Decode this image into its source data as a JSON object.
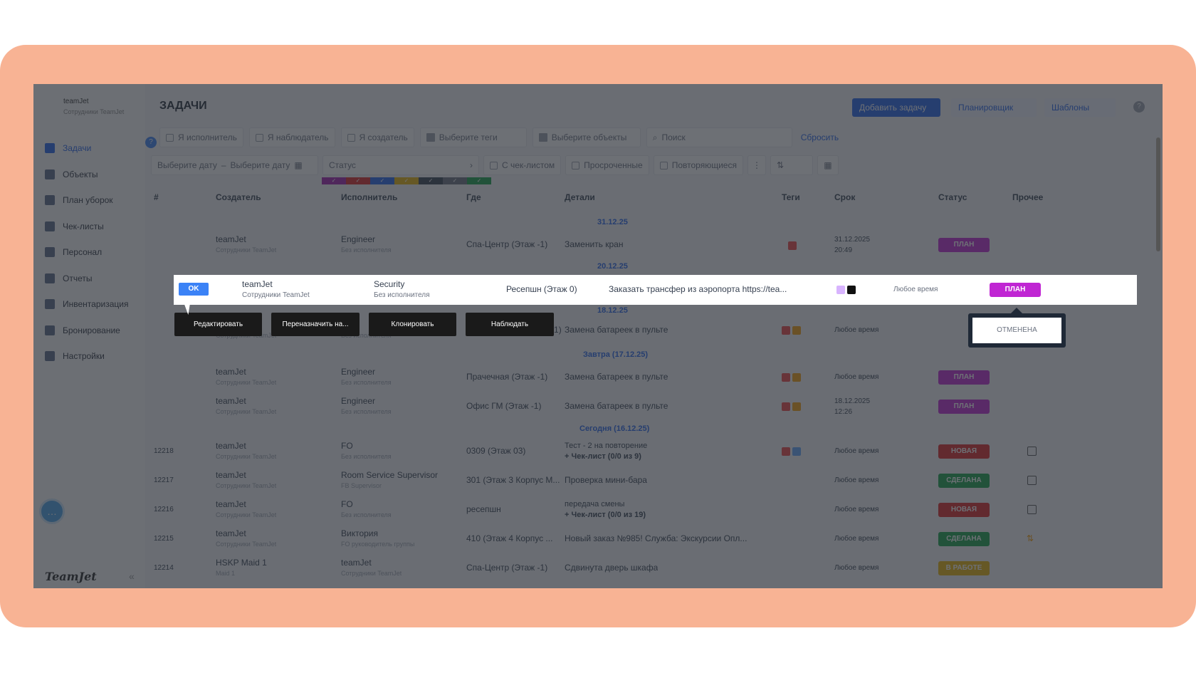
{
  "brand": {
    "name": "teamJet",
    "sub": "Сотрудники TeamJet",
    "logo": "TeamJet"
  },
  "sidebar": {
    "items": [
      {
        "label": "Задачи",
        "icon": "tasks-icon",
        "active": true
      },
      {
        "label": "Объекты",
        "icon": "objects-icon"
      },
      {
        "label": "План уборок",
        "icon": "cleaning-plan-icon"
      },
      {
        "label": "Чек-листы",
        "icon": "checklist-icon"
      },
      {
        "label": "Персонал",
        "icon": "staff-icon"
      },
      {
        "label": "Отчеты",
        "icon": "reports-icon"
      },
      {
        "label": "Инвентаризация",
        "icon": "inventory-icon"
      },
      {
        "label": "Бронирование",
        "icon": "booking-icon"
      },
      {
        "label": "Настройки",
        "icon": "settings-icon"
      }
    ]
  },
  "header": {
    "title": "ЗАДАЧИ",
    "add_task": "Добавить задачу",
    "planning": "Планировщик",
    "templates": "Шаблоны"
  },
  "filters": {
    "executor": "Я исполнитель",
    "observer": "Я наблюдатель",
    "creator": "Я создатель",
    "tags": "Выберите теги",
    "objects": "Выберите объекты",
    "search_placeholder": "Поиск",
    "reset": "Сбросить",
    "date_from": "Выберите дату",
    "date_to": "Выберите дату",
    "status": "Статус",
    "with_checklist": "С чек-листом",
    "overdue": "Просроченные",
    "recurring": "Повторяющиеся"
  },
  "columns": [
    "#",
    "Создатель",
    "Исполнитель",
    "Где",
    "Детали",
    "Теги",
    "Срок",
    "Статус",
    "Прочее"
  ],
  "dates": {
    "d1": "31.12.25",
    "d2": "20.12.25",
    "d3": "18.12.25",
    "d4": "Завтра (17.12.25)",
    "d5": "Сегодня (16.12.25)"
  },
  "rows": [
    {
      "id": "",
      "creator": "teamJet",
      "creator_sub": "Сотрудники TeamJet",
      "exec": "Engineer",
      "exec_sub": "Без исполнителя",
      "where": "Спа-Центр (Этаж -1)",
      "details": "Заменить кран",
      "details2": "",
      "deadline": "31.12.2025",
      "deadline2": "20:49",
      "status": "ПЛАН"
    },
    {
      "id": "",
      "creator": "",
      "creator_sub": "Сотрудники TeamJet",
      "exec": "",
      "exec_sub": "Без исполнителя",
      "where": "Этаж -1)",
      "details": "Замена батареек в пульте",
      "details2": "",
      "deadline": "Любое время",
      "deadline2": "",
      "status": ""
    },
    {
      "id": "",
      "creator": "teamJet",
      "creator_sub": "Сотрудники TeamJet",
      "exec": "Engineer",
      "exec_sub": "Без исполнителя",
      "where": "Прачечная (Этаж -1)",
      "details": "Замена батареек в пульте",
      "details2": "",
      "deadline": "Любое время",
      "deadline2": "",
      "status": "ПЛАН"
    },
    {
      "id": "",
      "creator": "teamJet",
      "creator_sub": "Сотрудники TeamJet",
      "exec": "Engineer",
      "exec_sub": "Без исполнителя",
      "where": "Офис ГМ (Этаж -1)",
      "details": "Замена батареек в пульте",
      "details2": "",
      "deadline": "18.12.2025",
      "deadline2": "12:26",
      "status": "ПЛАН"
    },
    {
      "id": "12218",
      "creator": "teamJet",
      "creator_sub": "Сотрудники TeamJet",
      "exec": "FO",
      "exec_sub": "Без исполнителя",
      "where": "0309 (Этаж 03)",
      "details": "Тест - 2 на повторение",
      "details2": "+ Чек-лист (0/0 из 9)",
      "deadline": "Любое время",
      "deadline2": "",
      "status": "НОВАЯ"
    },
    {
      "id": "12217",
      "creator": "teamJet",
      "creator_sub": "Сотрудники TeamJet",
      "exec": "Room Service Supervisor",
      "exec_sub": "FB Supervisor",
      "where": "301 (Этаж 3 Корпус М...",
      "details": "Проверка мини-бара",
      "details2": "",
      "deadline": "Любое время",
      "deadline2": "",
      "status": "СДЕЛАНА"
    },
    {
      "id": "12216",
      "creator": "teamJet",
      "creator_sub": "Сотрудники TeamJet",
      "exec": "FO",
      "exec_sub": "Без исполнителя",
      "where": "ресепшн",
      "details": "передача смены",
      "details2": "+ Чек-лист (0/0 из 19)",
      "deadline": "Любое время",
      "deadline2": "",
      "status": "НОВАЯ"
    },
    {
      "id": "12215",
      "creator": "teamJet",
      "creator_sub": "Сотрудники TeamJet",
      "exec": "Виктория",
      "exec_sub": "FO руководитель группы",
      "where": "410 (Этаж 4 Корпус ...",
      "details": "Новый заказ №985! Служба: Экскурсии Опл...",
      "details2": "",
      "deadline": "Любое время",
      "deadline2": "",
      "status": "СДЕЛАНА"
    },
    {
      "id": "12214",
      "creator": "HSKP Maid 1",
      "creator_sub": "Maid 1",
      "exec": "teamJet",
      "exec_sub": "Сотрудники TeamJet",
      "where": "Спа-Центр (Этаж -1)",
      "details": "Сдвинута дверь шкафа",
      "details2": "",
      "deadline": "Любое время",
      "deadline2": "",
      "status": "В РАБОТЕ"
    }
  ],
  "highlight": {
    "ok": "OK",
    "creator": "teamJet",
    "creator_sub": "Сотрудники TeamJet",
    "exec": "Security",
    "exec_sub": "Без исполнителя",
    "where": "Ресепшн (Этаж 0)",
    "details": "Заказать трансфер из аэропорта https://tea...",
    "deadline": "Любое время",
    "status": "ПЛАН"
  },
  "context_menu": {
    "edit": "Редактировать",
    "reassign": "Переназначить на...",
    "clone": "Клонировать",
    "observe": "Наблюдать"
  },
  "status_popup": {
    "cancelled": "ОТМЕНЕНА"
  },
  "colors": {
    "plan": "#c026d3",
    "new": "#dc2626",
    "done": "#16a34a",
    "in_work": "#eab308",
    "accent": "#2563eb",
    "frame": "#f8b394"
  }
}
